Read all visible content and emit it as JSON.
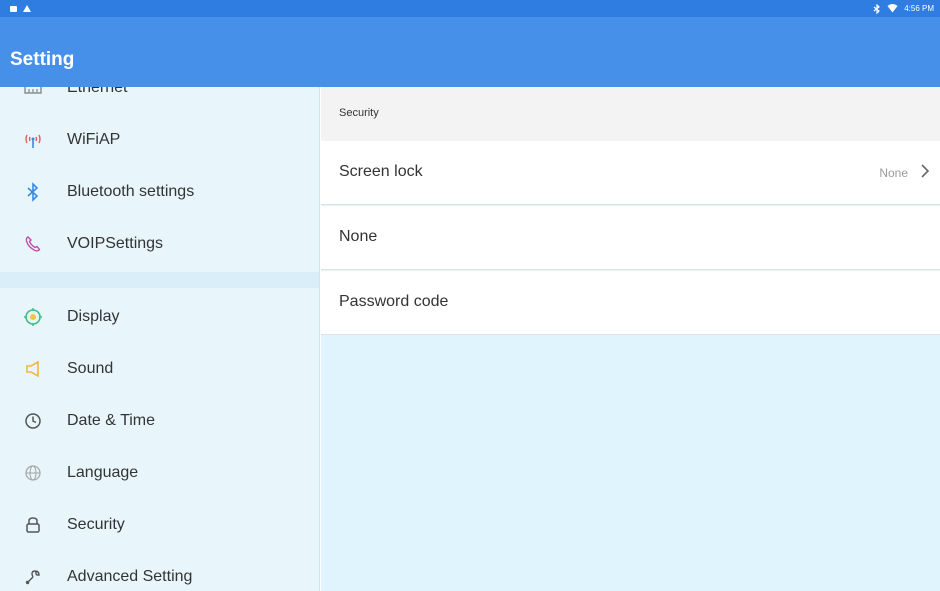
{
  "status_bar": {
    "time": "4:56 PM",
    "left_icons": [
      "notification-box-icon",
      "warning-triangle-icon"
    ],
    "right_icons": [
      "bluetooth-icon",
      "wifi-icon"
    ]
  },
  "app_bar": {
    "title": "Setting",
    "color": "#4690ea"
  },
  "sidebar": {
    "items": [
      {
        "label": "Ethernet",
        "icon": "ethernet-icon",
        "color": "#888888"
      },
      {
        "label": "WiFiAP",
        "icon": "wifi-ap-icon",
        "color": "#e06060"
      },
      {
        "label": "Bluetooth settings",
        "icon": "bluetooth-icon",
        "color": "#3a8be0"
      },
      {
        "label": "VOIPSettings",
        "icon": "phone-icon",
        "color": "#c04aa8"
      },
      {
        "label": "Display",
        "icon": "display-icon",
        "color": "#3fbf7f"
      },
      {
        "label": "Sound",
        "icon": "sound-icon",
        "color": "#f0b840"
      },
      {
        "label": "Date & Time",
        "icon": "clock-icon",
        "color": "#555555"
      },
      {
        "label": "Language",
        "icon": "globe-icon",
        "color": "#9a9a9a"
      },
      {
        "label": "Security",
        "icon": "lock-icon",
        "color": "#555555"
      },
      {
        "label": "Advanced Setting",
        "icon": "wrench-icon",
        "color": "#555555"
      }
    ]
  },
  "content": {
    "section_title": "Security",
    "rows": [
      {
        "label": "Screen lock",
        "value": "None"
      },
      {
        "label": "None",
        "value": ""
      },
      {
        "label": "Password code",
        "value": ""
      }
    ]
  }
}
